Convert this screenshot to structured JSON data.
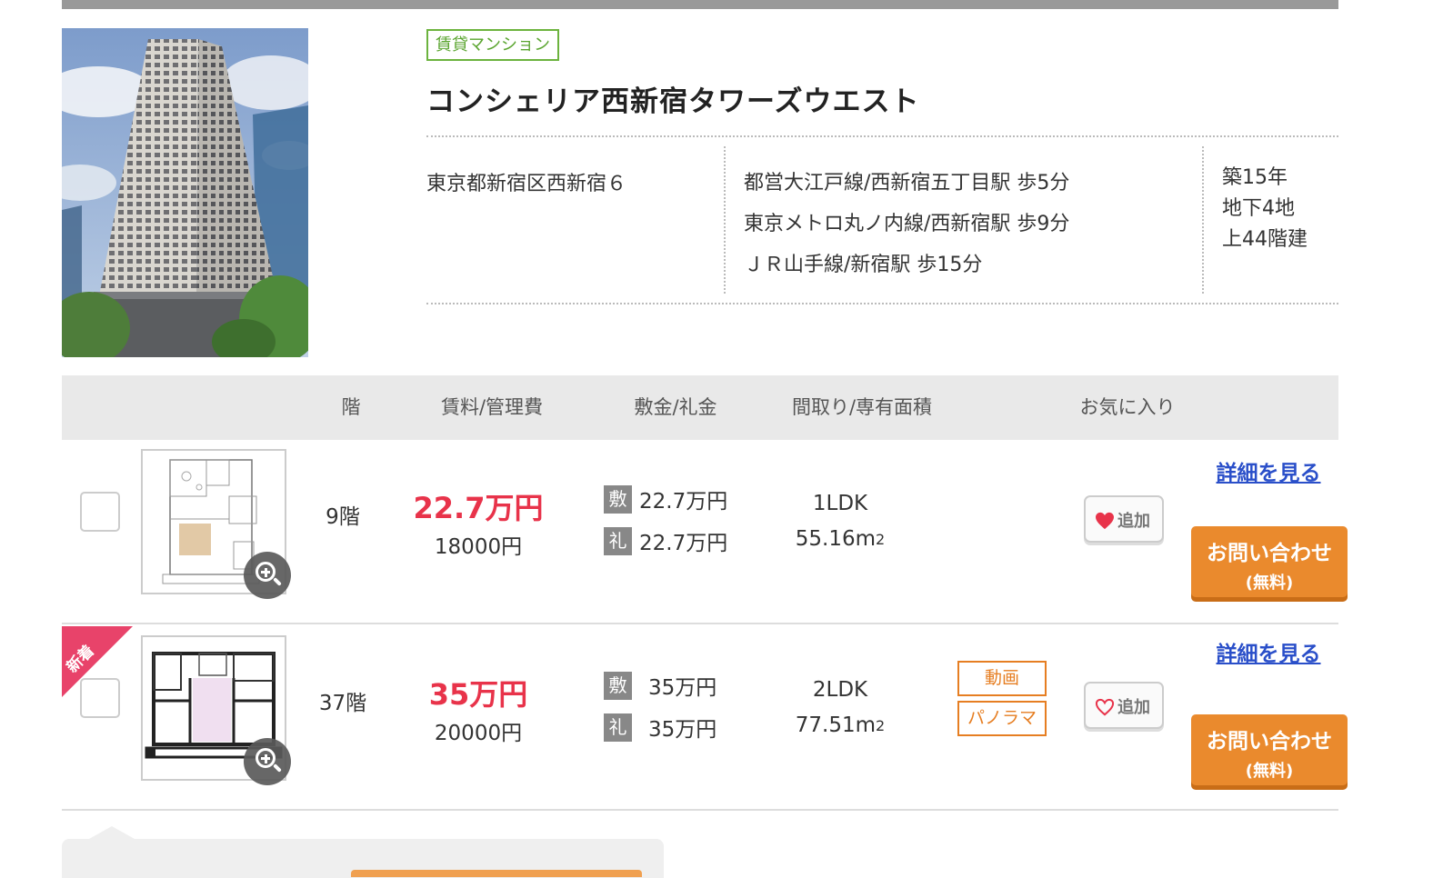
{
  "property": {
    "type_tag": "賃貸マンション",
    "name": "コンシェリア西新宿タワーズウエスト",
    "address": "東京都新宿区西新宿６",
    "stations": [
      "都営大江戸線/西新宿五丁目駅 歩5分",
      "東京メトロ丸ノ内線/西新宿駅 歩9分",
      "ＪＲ山手線/新宿駅 歩15分"
    ],
    "age": [
      "築15年",
      "地下4地",
      "上44階建"
    ]
  },
  "table_header": {
    "floor": "階",
    "rent": "賃料/管理費",
    "deposit": "敷金/礼金",
    "layout": "間取り/専有面積",
    "favorite": "お気に入り"
  },
  "units": [
    {
      "floor": "9階",
      "rent": "22.7万円",
      "fee": "18000円",
      "deposit_mark": "敷",
      "deposit": "22.7万円",
      "key_money_mark": "礼",
      "key_money": "22.7万円",
      "layout": "1LDK",
      "area": "55.16m",
      "area_sup": "2",
      "fav_label": "追加",
      "fav_active": true,
      "detail_label": "詳細を見る",
      "inquiry_main": "お問い合わせ",
      "inquiry_sub": "(無料)"
    },
    {
      "new_badge": "新着",
      "floor": "37階",
      "rent": "35万円",
      "fee": "20000円",
      "deposit_mark": "敷",
      "deposit": "35万円",
      "key_money_mark": "礼",
      "key_money": "35万円",
      "layout": "2LDK",
      "area": "77.51m",
      "area_sup": "2",
      "media_tags": [
        "動画",
        "パノラマ"
      ],
      "fav_label": "追加",
      "fav_active": false,
      "detail_label": "詳細を見る",
      "inquiry_main": "お問い合わせ",
      "inquiry_sub": "(無料)"
    }
  ],
  "colors": {
    "rent_red": "#e8334a",
    "tag_green": "#6cb33e",
    "accent_orange": "#ea8a2d",
    "link_blue": "#2a4fc9"
  }
}
